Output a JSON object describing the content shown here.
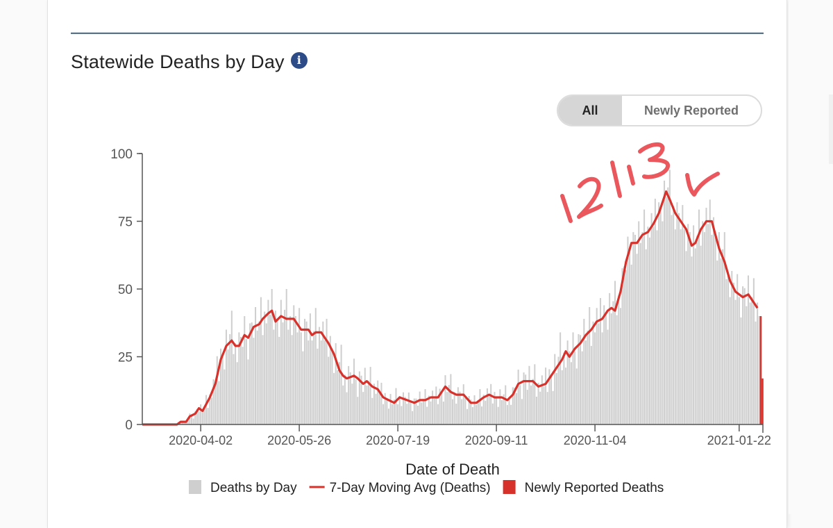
{
  "header": {
    "title": "Statewide Deaths by Day",
    "info_icon": "info-circle-icon"
  },
  "toggle": {
    "options": [
      "All",
      "Newly Reported"
    ],
    "selected": "All"
  },
  "annotation": {
    "handwritten_text": "12/13",
    "handwritten_mark": "check-arrow",
    "color": "#e8454c"
  },
  "colors": {
    "bars": "#cfcfcf",
    "moving_avg": "#d7312b",
    "newly_reported": "#d7312b",
    "axis": "#555555",
    "divider": "#5b7186",
    "info_icon": "#2c4b87"
  },
  "chart_data": {
    "type": "bar",
    "title": "Statewide Deaths by Day",
    "xlabel": "Date of Death",
    "ylabel": "",
    "ylim": [
      0,
      100
    ],
    "yticks": [
      0,
      25,
      50,
      75,
      100
    ],
    "x_start_date": "2020-03-01",
    "x_end_date": "2021-02-04",
    "xticks": [
      "2020-04-02",
      "2020-05-26",
      "2020-07-19",
      "2020-09-11",
      "2020-11-04",
      "2021-01-22"
    ],
    "grid": false,
    "legend_position": "bottom",
    "legend": [
      {
        "label": "Deaths by Day",
        "type": "bar",
        "color": "#cfcfcf"
      },
      {
        "label": "7-Day Moving Avg (Deaths)",
        "type": "line",
        "color": "#d7312b"
      },
      {
        "label": "Newly Reported Deaths",
        "type": "bar",
        "color": "#d7312b"
      }
    ],
    "series": [
      {
        "name": "7-Day Moving Avg (Deaths)",
        "type": "line",
        "keypoints": [
          [
            "2020-03-01",
            0
          ],
          [
            "2020-03-20",
            0
          ],
          [
            "2020-03-22",
            1
          ],
          [
            "2020-03-25",
            1
          ],
          [
            "2020-03-27",
            3
          ],
          [
            "2020-03-30",
            4
          ],
          [
            "2020-04-01",
            6
          ],
          [
            "2020-04-03",
            5
          ],
          [
            "2020-04-07",
            10
          ],
          [
            "2020-04-10",
            15
          ],
          [
            "2020-04-13",
            24
          ],
          [
            "2020-04-16",
            29
          ],
          [
            "2020-04-19",
            31
          ],
          [
            "2020-04-21",
            29
          ],
          [
            "2020-04-23",
            29
          ],
          [
            "2020-04-26",
            33
          ],
          [
            "2020-04-28",
            32
          ],
          [
            "2020-05-01",
            36
          ],
          [
            "2020-05-04",
            37
          ],
          [
            "2020-05-06",
            39
          ],
          [
            "2020-05-09",
            41
          ],
          [
            "2020-05-11",
            42
          ],
          [
            "2020-05-13",
            38
          ],
          [
            "2020-05-16",
            40
          ],
          [
            "2020-05-19",
            39
          ],
          [
            "2020-05-23",
            39
          ],
          [
            "2020-05-27",
            35
          ],
          [
            "2020-05-31",
            35
          ],
          [
            "2020-06-02",
            33
          ],
          [
            "2020-06-04",
            34
          ],
          [
            "2020-06-07",
            34
          ],
          [
            "2020-06-09",
            32
          ],
          [
            "2020-06-11",
            30
          ],
          [
            "2020-06-14",
            26
          ],
          [
            "2020-06-17",
            20
          ],
          [
            "2020-06-19",
            18
          ],
          [
            "2020-06-21",
            17
          ],
          [
            "2020-06-25",
            18
          ],
          [
            "2020-06-27",
            17
          ],
          [
            "2020-06-30",
            15
          ],
          [
            "2020-07-02",
            16
          ],
          [
            "2020-07-05",
            14
          ],
          [
            "2020-07-08",
            13
          ],
          [
            "2020-07-11",
            10
          ],
          [
            "2020-07-14",
            9
          ],
          [
            "2020-07-17",
            8
          ],
          [
            "2020-07-20",
            10
          ],
          [
            "2020-07-24",
            9
          ],
          [
            "2020-07-28",
            8
          ],
          [
            "2020-07-31",
            9
          ],
          [
            "2020-08-03",
            9
          ],
          [
            "2020-08-06",
            10
          ],
          [
            "2020-08-10",
            10
          ],
          [
            "2020-08-14",
            14
          ],
          [
            "2020-08-17",
            12
          ],
          [
            "2020-08-20",
            11
          ],
          [
            "2020-08-24",
            11
          ],
          [
            "2020-08-28",
            8
          ],
          [
            "2020-08-31",
            8
          ],
          [
            "2020-09-04",
            10
          ],
          [
            "2020-09-07",
            11
          ],
          [
            "2020-09-10",
            10
          ],
          [
            "2020-09-14",
            10
          ],
          [
            "2020-09-17",
            9
          ],
          [
            "2020-09-20",
            11
          ],
          [
            "2020-09-23",
            15
          ],
          [
            "2020-09-26",
            16
          ],
          [
            "2020-10-01",
            16
          ],
          [
            "2020-10-04",
            14
          ],
          [
            "2020-10-08",
            15
          ],
          [
            "2020-10-11",
            18
          ],
          [
            "2020-10-14",
            21
          ],
          [
            "2020-10-17",
            24
          ],
          [
            "2020-10-19",
            27
          ],
          [
            "2020-10-21",
            25
          ],
          [
            "2020-10-24",
            28
          ],
          [
            "2020-10-27",
            30
          ],
          [
            "2020-10-30",
            33
          ],
          [
            "2020-11-02",
            35
          ],
          [
            "2020-11-05",
            38
          ],
          [
            "2020-11-08",
            39
          ],
          [
            "2020-11-11",
            42
          ],
          [
            "2020-11-13",
            43
          ],
          [
            "2020-11-15",
            42
          ],
          [
            "2020-11-18",
            49
          ],
          [
            "2020-11-21",
            60
          ],
          [
            "2020-11-24",
            67
          ],
          [
            "2020-11-27",
            67
          ],
          [
            "2020-11-30",
            70
          ],
          [
            "2020-12-03",
            71
          ],
          [
            "2020-12-06",
            74
          ],
          [
            "2020-12-09",
            78
          ],
          [
            "2020-12-11",
            82
          ],
          [
            "2020-12-13",
            86
          ],
          [
            "2020-12-15",
            83
          ],
          [
            "2020-12-18",
            78
          ],
          [
            "2020-12-21",
            75
          ],
          [
            "2020-12-24",
            72
          ],
          [
            "2020-12-27",
            66
          ],
          [
            "2020-12-29",
            67
          ],
          [
            "2021-01-01",
            72
          ],
          [
            "2021-01-04",
            75
          ],
          [
            "2021-01-07",
            75
          ],
          [
            "2021-01-09",
            70
          ],
          [
            "2021-01-11",
            65
          ],
          [
            "2021-01-14",
            60
          ],
          [
            "2021-01-17",
            53
          ],
          [
            "2021-01-20",
            49
          ],
          [
            "2021-01-24",
            47
          ],
          [
            "2021-01-27",
            48
          ],
          [
            "2021-01-30",
            45
          ],
          [
            "2021-02-01",
            43
          ]
        ]
      },
      {
        "name": "Deaths by Day",
        "type": "bar",
        "daily_offsets_note": "bar value = moving avg + offset",
        "offset_pattern": [
          3,
          -4,
          7,
          -2,
          1,
          9,
          -6,
          2,
          -3,
          5,
          -1,
          8,
          -5,
          4,
          0,
          -7,
          6,
          -2,
          3,
          11,
          -4,
          1,
          -6,
          5,
          2,
          -3,
          7,
          -1,
          -8,
          4
        ]
      },
      {
        "name": "Newly Reported Deaths",
        "type": "bar",
        "points": [
          [
            "2021-02-03",
            40
          ],
          [
            "2021-02-04",
            17
          ]
        ]
      }
    ]
  }
}
